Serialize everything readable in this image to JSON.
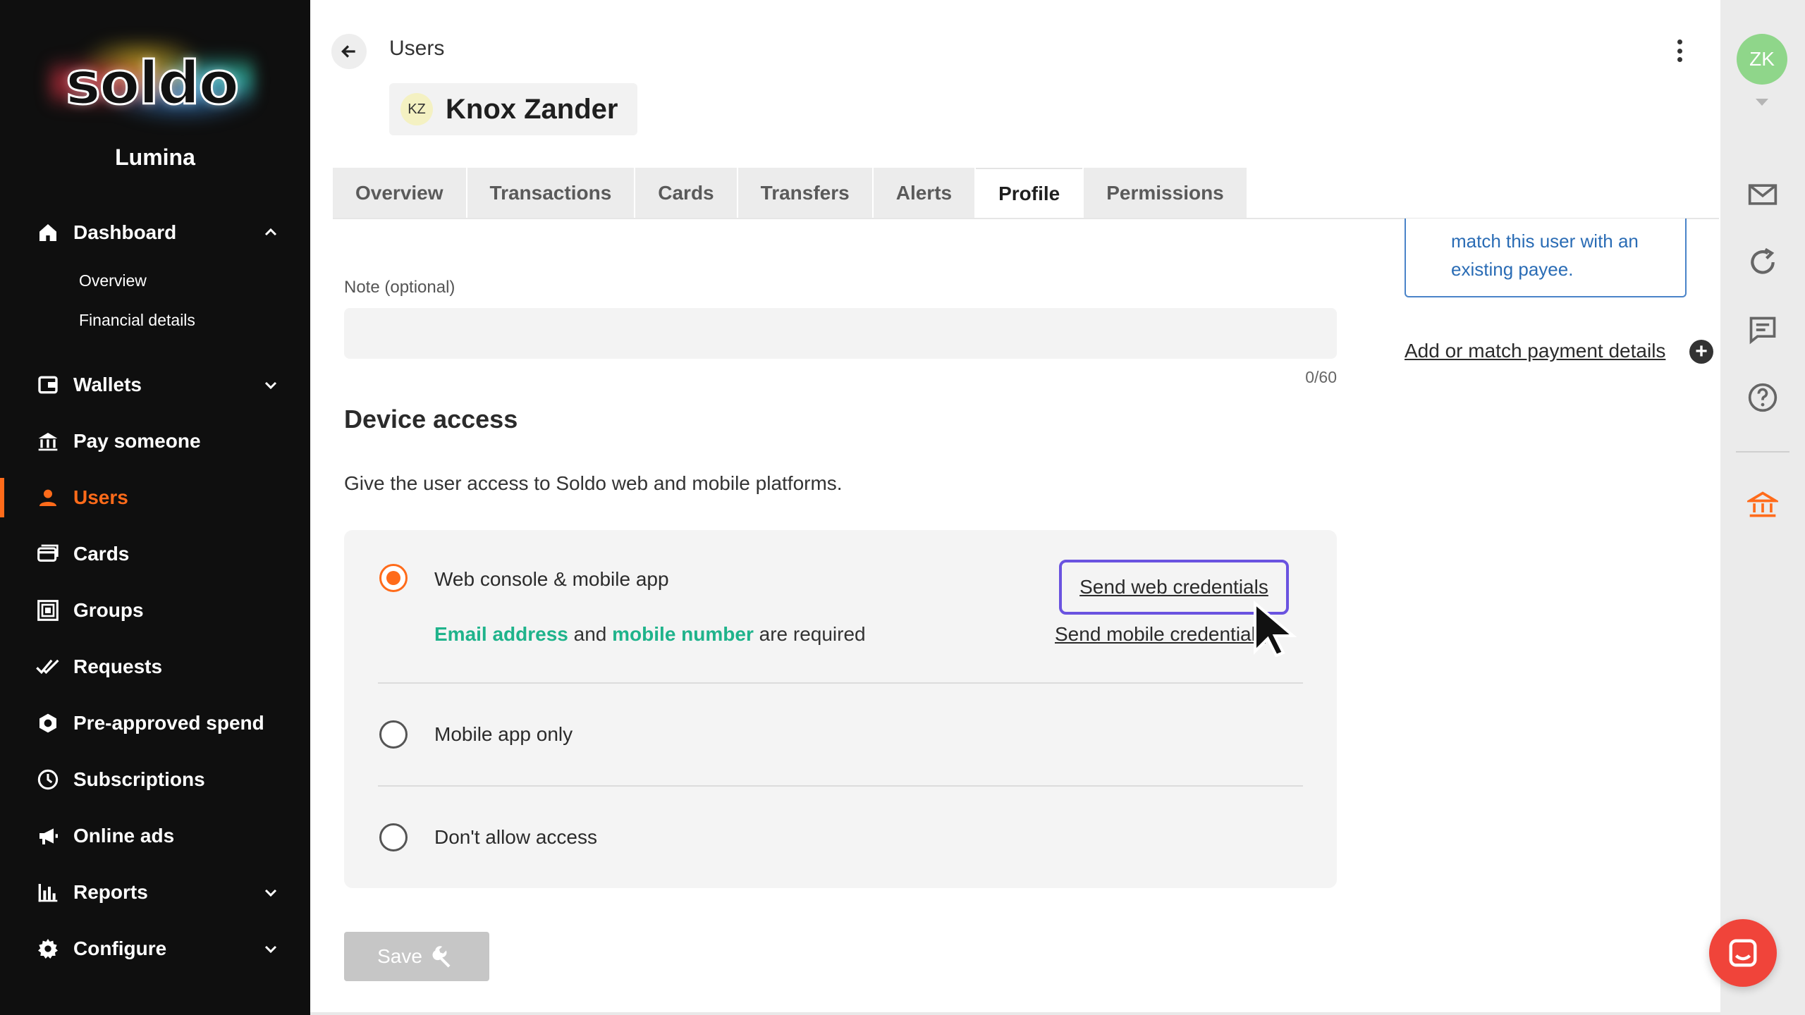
{
  "sidebar": {
    "logo_text": "soldo",
    "company": "Lumina",
    "nav": {
      "dashboard": "Dashboard",
      "overview": "Overview",
      "financial_details": "Financial details",
      "wallets": "Wallets",
      "pay_someone": "Pay someone",
      "users": "Users",
      "cards": "Cards",
      "groups": "Groups",
      "requests": "Requests",
      "pre_approved": "Pre-approved spend",
      "subscriptions": "Subscriptions",
      "online_ads": "Online ads",
      "reports": "Reports",
      "configure": "Configure"
    }
  },
  "header": {
    "breadcrumb": "Users",
    "user_initials": "KZ",
    "user_name": "Knox Zander"
  },
  "tabs": [
    "Overview",
    "Transactions",
    "Cards",
    "Transfers",
    "Alerts",
    "Profile",
    "Permissions"
  ],
  "active_tab": "Profile",
  "note": {
    "label": "Note (optional)",
    "value": "",
    "counter": "0/60"
  },
  "device_access": {
    "title": "Device access",
    "description": "Give the user access to Soldo web and mobile platforms.",
    "option_web": "Web console & mobile app",
    "req_email": "Email address",
    "req_and": " and ",
    "req_mobile": "mobile number",
    "req_suffix": " are required",
    "send_web": "Send web credentials",
    "send_mobile": "Send mobile credentials",
    "option_mobile": "Mobile app only",
    "option_none": "Don't allow access",
    "selected": "Web console & mobile app"
  },
  "save_label": "Save",
  "info_card": {
    "line1": "match this user with an",
    "line2": "existing payee."
  },
  "add_match_link": "Add or match payment details",
  "rail": {
    "avatar_initials": "ZK"
  },
  "colors": {
    "accent": "#ff6b1a",
    "teal": "#1fb38b",
    "focus": "#6a53e0",
    "link_blue": "#2a6cb5",
    "chat": "#f0443a"
  }
}
